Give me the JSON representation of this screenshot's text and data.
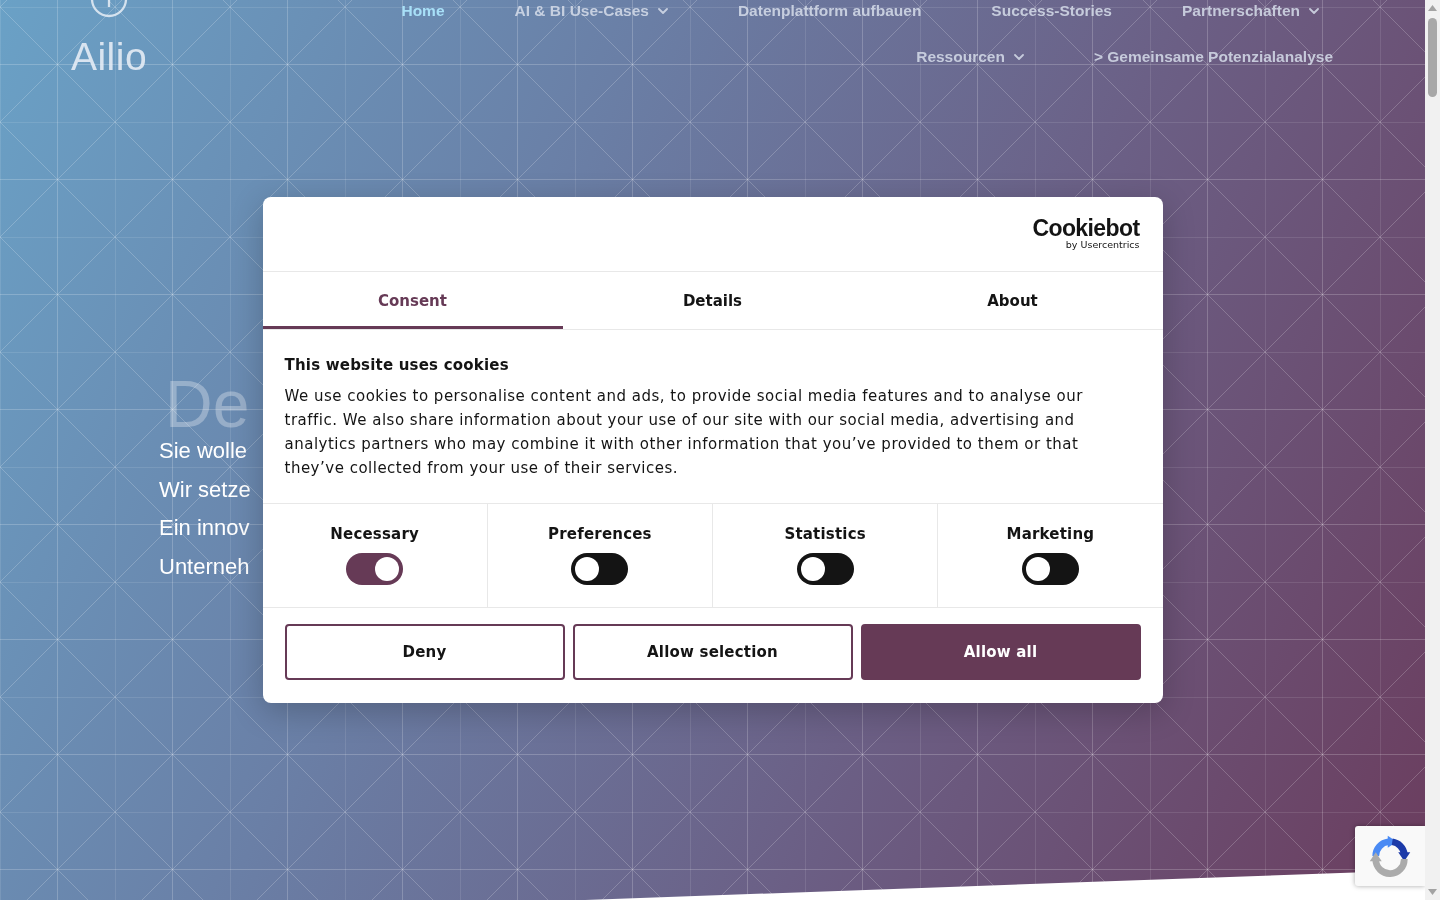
{
  "logo": {
    "text": "Ailio"
  },
  "nav_rows": [
    {
      "items": [
        {
          "label": "Home",
          "selected": true,
          "dropdown": false
        },
        {
          "label": "AI & BI Use-Cases",
          "selected": false,
          "dropdown": true
        },
        {
          "label": "Datenplattform aufbauen",
          "selected": false,
          "dropdown": false
        },
        {
          "label": "Success-Stories",
          "selected": false,
          "dropdown": false
        },
        {
          "label": "Partnerschaften",
          "selected": false,
          "dropdown": true
        }
      ]
    },
    {
      "items": [
        {
          "label": "Ressourcen",
          "selected": false,
          "dropdown": true
        },
        {
          "label": "> Gemeinsame Potenzialanalyse",
          "selected": false,
          "dropdown": false
        }
      ]
    }
  ],
  "hero": {
    "heading": "De",
    "lines": [
      "Sie wolle",
      "Wir setze",
      "Ein innov",
      "Unterneh"
    ]
  },
  "cookie_dialog": {
    "brand": {
      "name": "Cookiebot",
      "tagline": "by Usercentrics"
    },
    "tabs": [
      {
        "label": "Consent",
        "selected": true
      },
      {
        "label": "Details",
        "selected": false
      },
      {
        "label": "About",
        "selected": false
      }
    ],
    "title": "This website uses cookies",
    "text": "We use cookies to personalise content and ads, to provide social media features and to analyse our traffic. We also share information about your use of our site with our social media, advertising and analytics partners who may combine it with other information that you’ve provided to them or that they’ve collected from your use of their services.",
    "categories": [
      {
        "label": "Necessary",
        "checked": true
      },
      {
        "label": "Preferences",
        "checked": false
      },
      {
        "label": "Statistics",
        "checked": false
      },
      {
        "label": "Marketing",
        "checked": false
      }
    ],
    "buttons": [
      {
        "label": "Deny",
        "kind": "outline"
      },
      {
        "label": "Allow selection",
        "kind": "outline"
      },
      {
        "label": "Allow all",
        "kind": "filled"
      }
    ]
  }
}
